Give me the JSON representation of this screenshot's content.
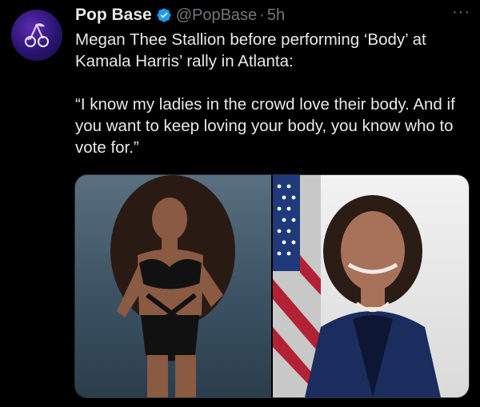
{
  "tweet": {
    "author_name": "Pop Base",
    "handle": "@PopBase",
    "separator": "·",
    "time": "5h",
    "more_label": "···",
    "text": "Megan Thee Stallion before performing ‘Body’ at Kamala Harris’ rally in Atlanta:\n\n“I know my ladies in the crowd love their body. And if you want to keep loving your body, you know who to vote for.”"
  },
  "icons": {
    "avatar": "cherry-logo-icon",
    "verified": "verified-badge-icon",
    "more": "more-options-icon"
  },
  "colors": {
    "background": "#000000",
    "text_primary": "#e7e9ea",
    "text_secondary": "#71767b",
    "verified_blue": "#1d9bf0",
    "avatar_purple": "#4b24a3"
  }
}
